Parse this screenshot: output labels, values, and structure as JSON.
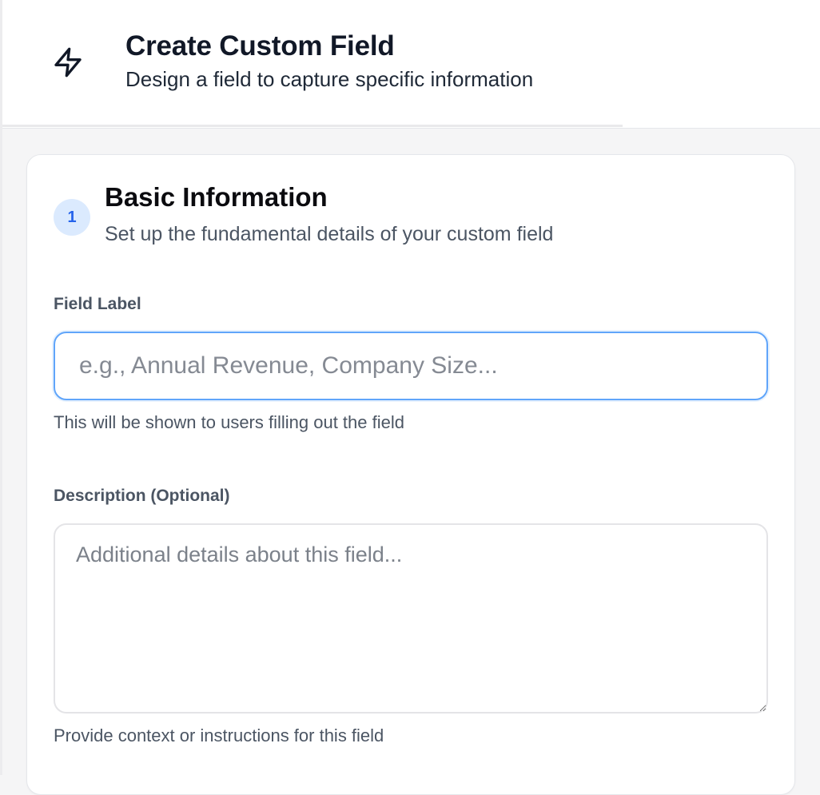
{
  "header": {
    "icon": "lightning-bolt-icon",
    "title": "Create Custom Field",
    "subtitle": "Design a field to capture specific information"
  },
  "section": {
    "step_number": "1",
    "title": "Basic Information",
    "subtitle": "Set up the fundamental details of your custom field"
  },
  "field_label": {
    "label": "Field Label",
    "value": "",
    "placeholder": "e.g., Annual Revenue, Company Size...",
    "help": "This will be shown to users filling out the field"
  },
  "description": {
    "label": "Description (Optional)",
    "value": "",
    "placeholder": "Additional details about this field...",
    "help": "Provide context or instructions for this field"
  },
  "colors": {
    "accent": "#60a5fa",
    "badge_bg": "#dbeafe",
    "badge_text": "#2563eb"
  }
}
